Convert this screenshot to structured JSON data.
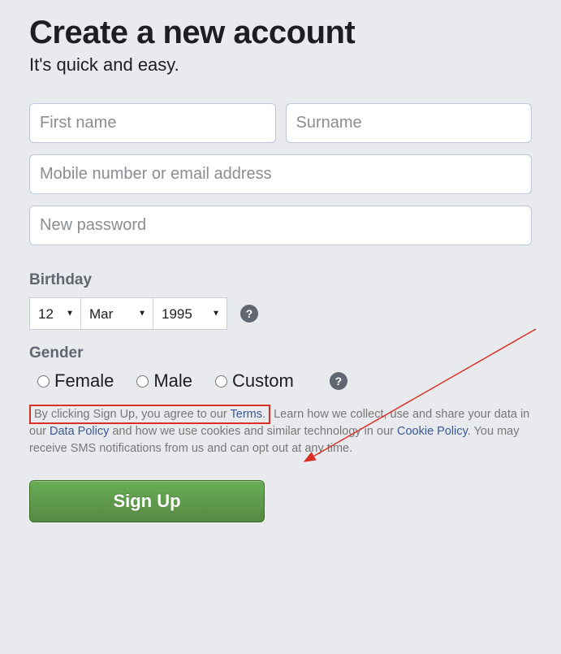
{
  "header": {
    "title": "Create a new account",
    "subtitle": "It's quick and easy."
  },
  "fields": {
    "first_name_placeholder": "First name",
    "surname_placeholder": "Surname",
    "contact_placeholder": "Mobile number or email address",
    "password_placeholder": "New password"
  },
  "birthday": {
    "label": "Birthday",
    "day": "12",
    "month": "Mar",
    "year": "1995"
  },
  "gender": {
    "label": "Gender",
    "options": {
      "female": "Female",
      "male": "Male",
      "custom": "Custom"
    }
  },
  "terms": {
    "boxed_prefix": "By clicking Sign Up, you agree to our ",
    "terms_link": "Terms",
    "after_terms": ". ",
    "learn_part1": "Learn how we collect, use and share your data in our ",
    "data_policy_link": "Data Policy",
    "learn_part2": " and how we use cookies and similar technology in our ",
    "cookie_policy_link": "Cookie Policy",
    "learn_part3": ". You may receive SMS notifications from us and can opt out at any time."
  },
  "signup_button": "Sign Up",
  "help_icon_glyph": "?"
}
